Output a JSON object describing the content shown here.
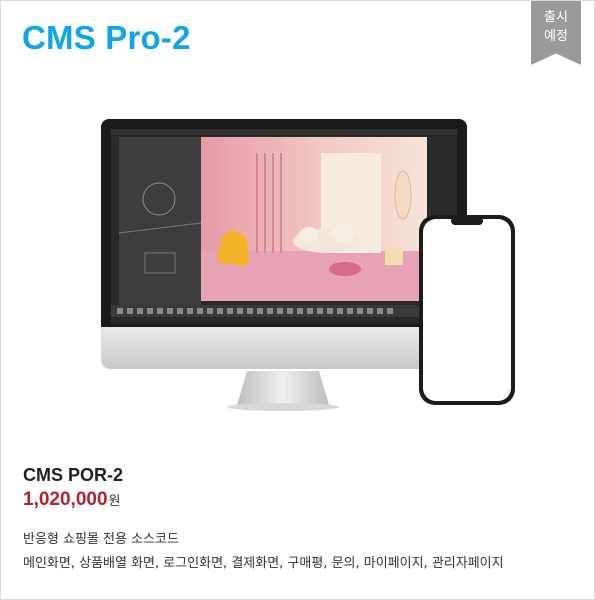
{
  "header": {
    "title": "CMS Pro-2"
  },
  "ribbon": {
    "line1": "출시",
    "line2": "예정"
  },
  "product": {
    "name": "CMS POR-2",
    "price": "1,020,000",
    "currency": "원",
    "desc_line1": "반응형 쇼핑몰 전용 소스코드",
    "desc_line2": "메인화면, 상품배열 화면, 로그인화면, 결제화면, 구매평, 문의, 마이페이지, 관리자페이지"
  },
  "colors": {
    "brand": "#13a5ec",
    "price": "#b5232e",
    "ribbon": "#9a9a9a"
  },
  "illustration": {
    "monitor_icon": "imac-monitor-icon",
    "phone_icon": "smartphone-icon"
  }
}
